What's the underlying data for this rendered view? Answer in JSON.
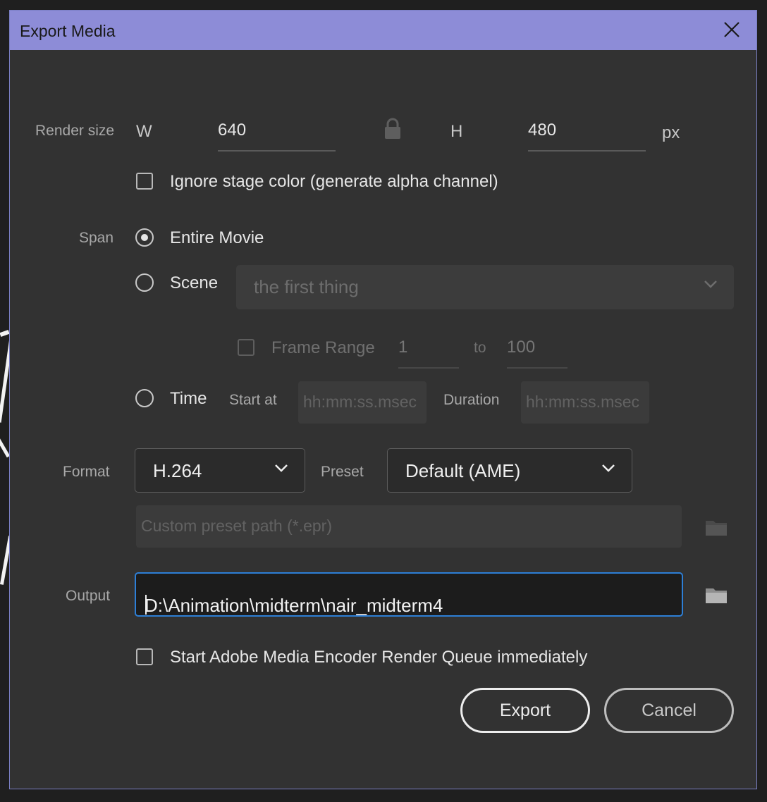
{
  "dialog": {
    "title": "Export Media",
    "close_icon": "close-icon"
  },
  "render_size": {
    "label": "Render size",
    "w_label": "W",
    "w_value": "640",
    "lock_icon": "lock-icon",
    "h_label": "H",
    "h_value": "480",
    "unit": "px"
  },
  "ignore_stage": {
    "label": "Ignore stage color (generate alpha channel)",
    "checked": false
  },
  "span": {
    "label": "Span",
    "entire_movie": "Entire Movie",
    "scene": "Scene",
    "scene_value": "the first thing",
    "frame_range": "Frame Range",
    "frame_from": "1",
    "to": "to",
    "frame_to": "100",
    "time": "Time",
    "start_at": "Start at",
    "start_placeholder": "hh:mm:ss.msec",
    "duration": "Duration",
    "duration_placeholder": "hh:mm:ss.msec",
    "selected": "Entire Movie"
  },
  "format": {
    "label": "Format",
    "value": "H.264",
    "preset_label": "Preset",
    "preset_value": "Default (AME)",
    "custom_preset_placeholder": "Custom preset path (*.epr)"
  },
  "output": {
    "label": "Output",
    "value": "D:\\Animation\\midterm\\nair_midterm4",
    "folder_icon": "folder-icon"
  },
  "start_queue": {
    "label": "Start Adobe Media Encoder Render Queue immediately",
    "checked": false
  },
  "buttons": {
    "export": "Export",
    "cancel": "Cancel"
  },
  "colors": {
    "titlebar": "#8d8cd7",
    "dialog_bg": "#323232",
    "focus_border": "#2d7fd6"
  }
}
